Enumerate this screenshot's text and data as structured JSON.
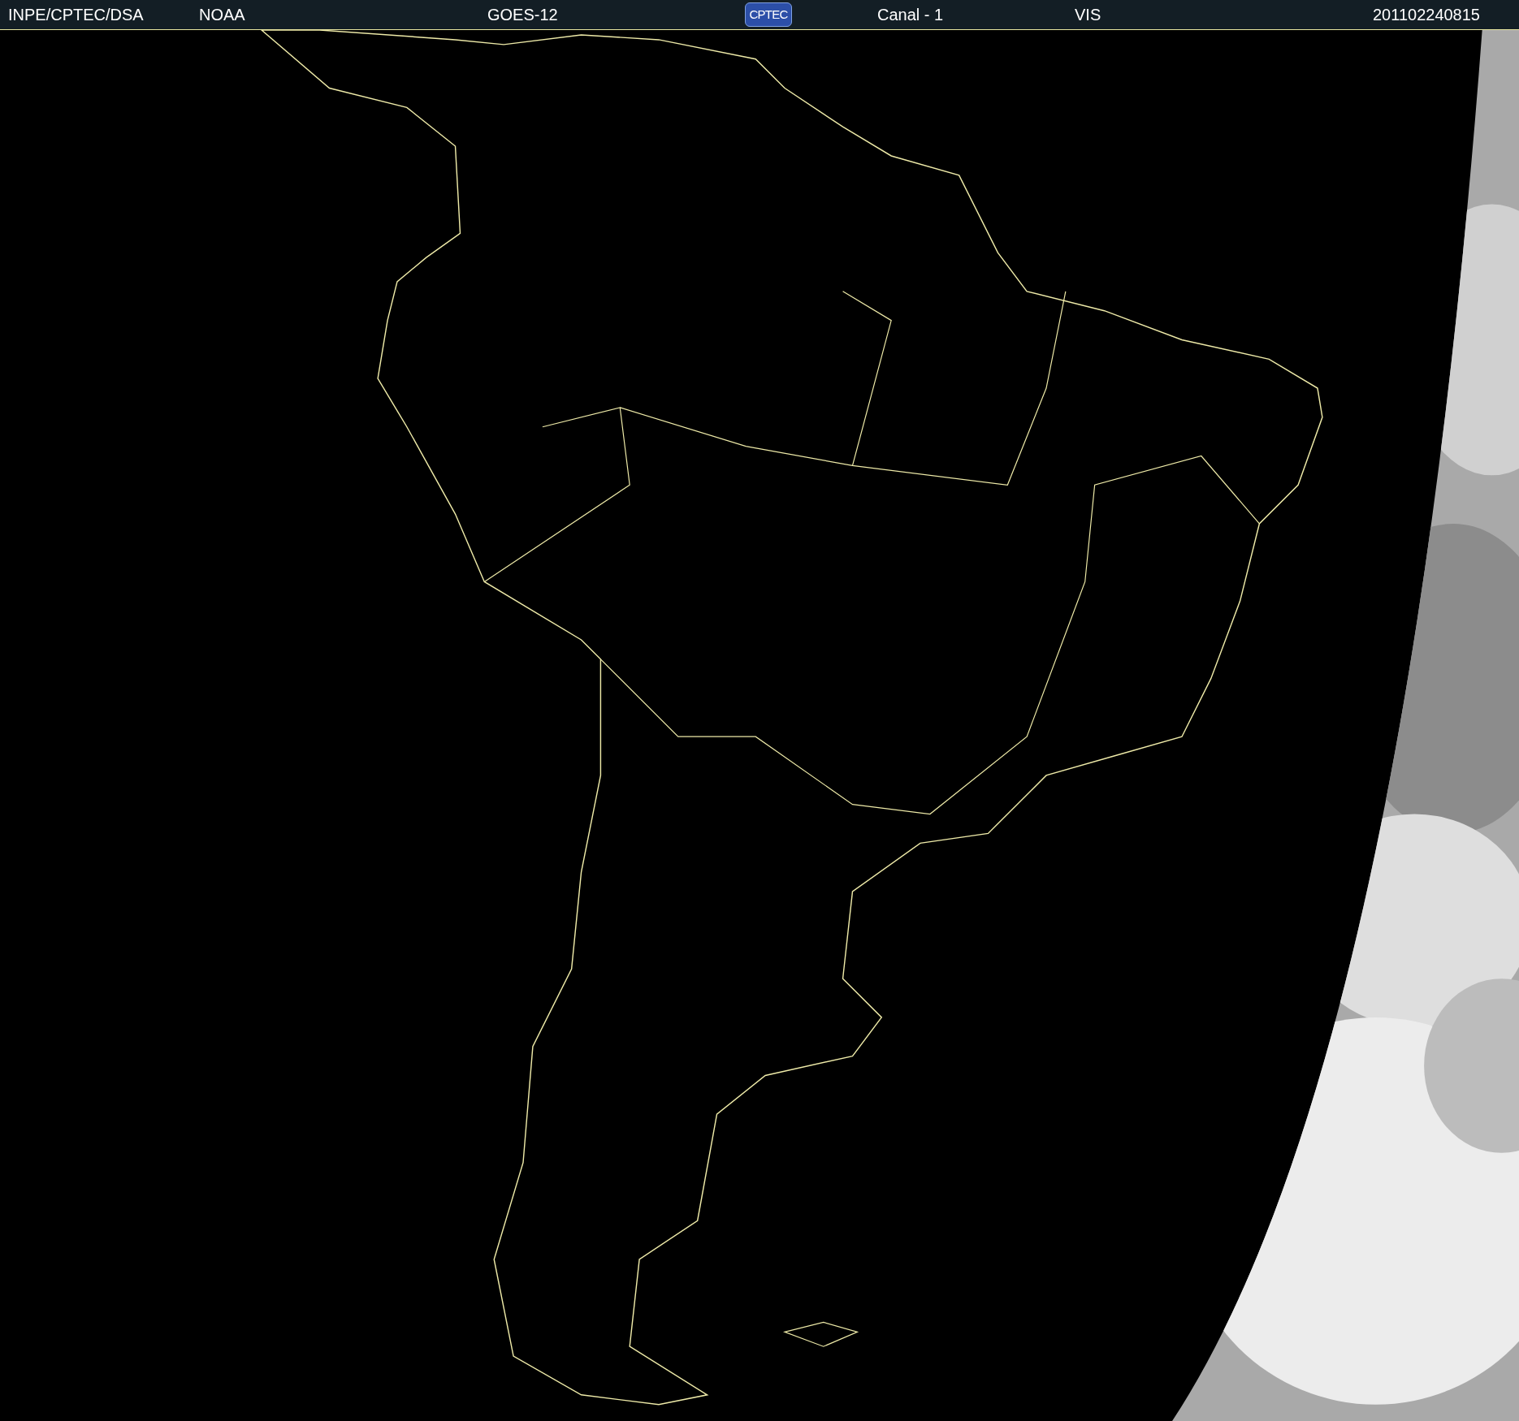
{
  "header": {
    "items": [
      {
        "kind": "text",
        "text": "INPE/CPTEC/DSA"
      },
      {
        "kind": "text",
        "text": "NOAA"
      },
      {
        "kind": "text",
        "text": "GOES-12"
      },
      {
        "kind": "logo",
        "text": "CPTEC"
      },
      {
        "kind": "text",
        "text": "Canal - 1"
      },
      {
        "kind": "text",
        "text": "VIS"
      },
      {
        "kind": "text",
        "text": "201102240815"
      }
    ]
  }
}
